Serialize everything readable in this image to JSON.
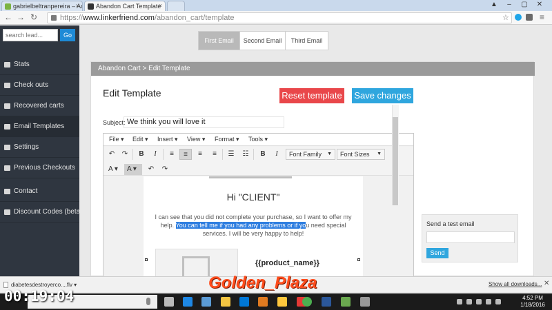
{
  "browser": {
    "tabs": [
      {
        "label": "gabrielbeltranpereira – Ac",
        "active": false
      },
      {
        "label": "Abandon Cart Template",
        "active": true
      }
    ],
    "url_scheme": "https://",
    "url_host": "www.linkerfriend.com",
    "url_path": "/abandon_cart/template"
  },
  "sidebar": {
    "search_placeholder": "search lead...",
    "go_label": "Go",
    "items": [
      {
        "label": "Stats",
        "icon": "bar-chart-icon"
      },
      {
        "label": "Check outs",
        "icon": "tag-icon"
      },
      {
        "label": "Recovered carts",
        "icon": "cart-icon"
      },
      {
        "label": "Email Templates",
        "icon": "edit-icon",
        "active": true
      },
      {
        "label": "Settings",
        "icon": "gear-icon"
      },
      {
        "label": "Previous Checkouts",
        "icon": "cart-icon"
      },
      {
        "label": "Contact",
        "icon": "chat-icon"
      },
      {
        "label": "Discount Codes (beta)",
        "icon": "comment-icon"
      }
    ]
  },
  "email_tabs": [
    {
      "label": "First Email",
      "active": true
    },
    {
      "label": "Second Email",
      "active": false
    },
    {
      "label": "Third Email",
      "active": false
    }
  ],
  "panel": {
    "breadcrumb": "Abandon Cart > Edit Template",
    "title": "Edit Template",
    "reset_label": "Reset template",
    "save_label": "Save changes",
    "subject_label": "Subject:",
    "subject_value": "We think you will love it"
  },
  "editor": {
    "menus": [
      "File",
      "Edit",
      "Insert",
      "View",
      "Format",
      "Tools"
    ],
    "font_family_label": "Font Family",
    "font_sizes_label": "Font Sizes",
    "greeting": "Hi \"CLIENT\"",
    "body_before": "I can see that you did not complete your purchase, so I want to offer my help.",
    "body_highlight": "You can tell me if you had any problems or if yo",
    "body_after": "u need special services. I will be very happy to help!",
    "product_placeholder": "{{product_name}}"
  },
  "test_email": {
    "label": "Send a test email",
    "send_label": "Send"
  },
  "downloads": {
    "file": "diabetesdestroyerco....flv",
    "show_all": "Show all downloads..."
  },
  "overlay": {
    "timer": "00:19:04",
    "watermark": "Golden_Plaza"
  },
  "taskbar": {
    "time": "4:52 PM",
    "date": "1/18/2016"
  },
  "colors": {
    "sidebar_bg": "#2f3640",
    "reset": "#e9474a",
    "save": "#2fa6de",
    "highlight": "#2e7ee0"
  }
}
